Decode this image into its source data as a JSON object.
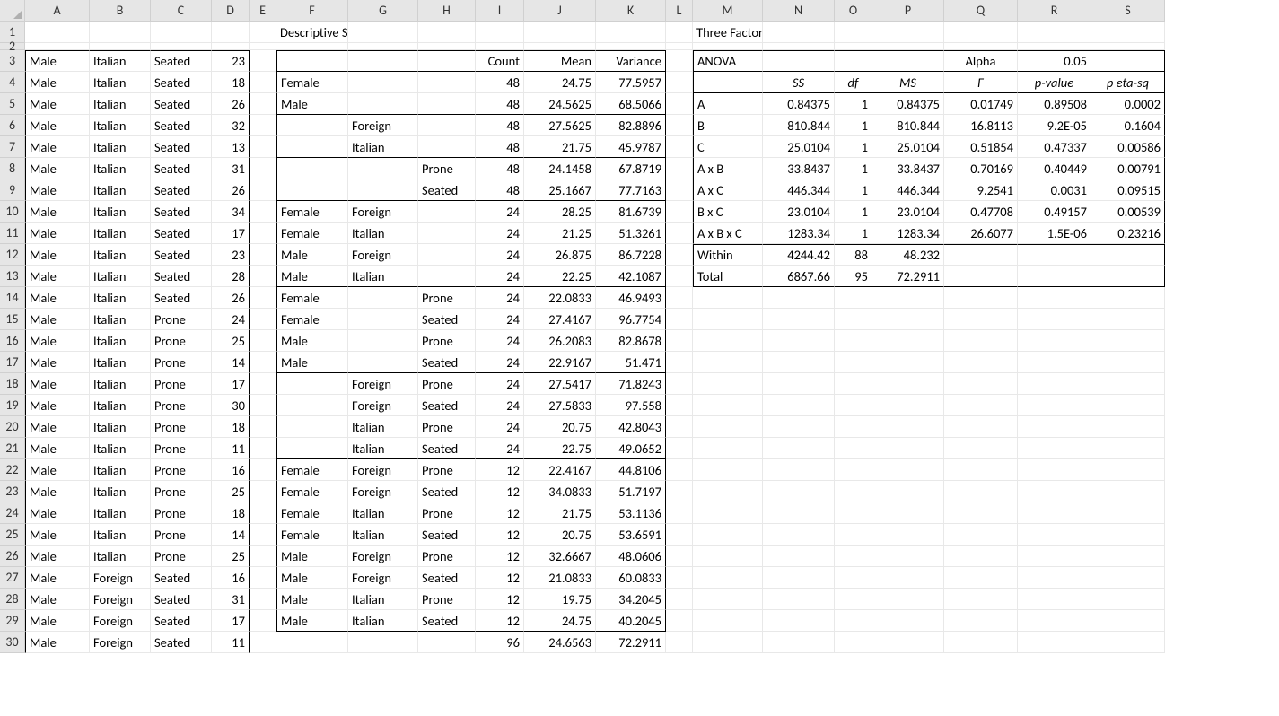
{
  "columns": [
    "A",
    "B",
    "C",
    "D",
    "E",
    "F",
    "G",
    "H",
    "I",
    "J",
    "K",
    "L",
    "M",
    "N",
    "O",
    "P",
    "Q",
    "R",
    "S"
  ],
  "rowCount": 30,
  "titles": {
    "descr": "Descriptive Statistics",
    "anova3": "Three Factor Anova (via Regression)"
  },
  "descrHeaders": {
    "count": "Count",
    "mean": "Mean",
    "variance": "Variance"
  },
  "anovaHeaders": {
    "anova": "ANOVA",
    "alpha": "Alpha",
    "alphaVal": "0.05",
    "ss": "SS",
    "df": "df",
    "ms": "MS",
    "F": "F",
    "pval": "p-value",
    "peta": "p eta-sq"
  },
  "raw": [
    {
      "r": 3,
      "a": "Male",
      "b": "Italian",
      "c": "Seated",
      "d": 23
    },
    {
      "r": 4,
      "a": "Male",
      "b": "Italian",
      "c": "Seated",
      "d": 18
    },
    {
      "r": 5,
      "a": "Male",
      "b": "Italian",
      "c": "Seated",
      "d": 26
    },
    {
      "r": 6,
      "a": "Male",
      "b": "Italian",
      "c": "Seated",
      "d": 32
    },
    {
      "r": 7,
      "a": "Male",
      "b": "Italian",
      "c": "Seated",
      "d": 13
    },
    {
      "r": 8,
      "a": "Male",
      "b": "Italian",
      "c": "Seated",
      "d": 31
    },
    {
      "r": 9,
      "a": "Male",
      "b": "Italian",
      "c": "Seated",
      "d": 26
    },
    {
      "r": 10,
      "a": "Male",
      "b": "Italian",
      "c": "Seated",
      "d": 34
    },
    {
      "r": 11,
      "a": "Male",
      "b": "Italian",
      "c": "Seated",
      "d": 17
    },
    {
      "r": 12,
      "a": "Male",
      "b": "Italian",
      "c": "Seated",
      "d": 23
    },
    {
      "r": 13,
      "a": "Male",
      "b": "Italian",
      "c": "Seated",
      "d": 28
    },
    {
      "r": 14,
      "a": "Male",
      "b": "Italian",
      "c": "Seated",
      "d": 26
    },
    {
      "r": 15,
      "a": "Male",
      "b": "Italian",
      "c": "Prone",
      "d": 24
    },
    {
      "r": 16,
      "a": "Male",
      "b": "Italian",
      "c": "Prone",
      "d": 25
    },
    {
      "r": 17,
      "a": "Male",
      "b": "Italian",
      "c": "Prone",
      "d": 14
    },
    {
      "r": 18,
      "a": "Male",
      "b": "Italian",
      "c": "Prone",
      "d": 17
    },
    {
      "r": 19,
      "a": "Male",
      "b": "Italian",
      "c": "Prone",
      "d": 30
    },
    {
      "r": 20,
      "a": "Male",
      "b": "Italian",
      "c": "Prone",
      "d": 18
    },
    {
      "r": 21,
      "a": "Male",
      "b": "Italian",
      "c": "Prone",
      "d": 11
    },
    {
      "r": 22,
      "a": "Male",
      "b": "Italian",
      "c": "Prone",
      "d": 16
    },
    {
      "r": 23,
      "a": "Male",
      "b": "Italian",
      "c": "Prone",
      "d": 25
    },
    {
      "r": 24,
      "a": "Male",
      "b": "Italian",
      "c": "Prone",
      "d": 18
    },
    {
      "r": 25,
      "a": "Male",
      "b": "Italian",
      "c": "Prone",
      "d": 14
    },
    {
      "r": 26,
      "a": "Male",
      "b": "Italian",
      "c": "Prone",
      "d": 25
    },
    {
      "r": 27,
      "a": "Male",
      "b": "Foreign",
      "c": "Seated",
      "d": 16
    },
    {
      "r": 28,
      "a": "Male",
      "b": "Foreign",
      "c": "Seated",
      "d": 31
    },
    {
      "r": 29,
      "a": "Male",
      "b": "Foreign",
      "c": "Seated",
      "d": 17
    },
    {
      "r": 30,
      "a": "Male",
      "b": "Foreign",
      "c": "Seated",
      "d": 11
    }
  ],
  "descr": [
    {
      "r": 4,
      "f": "Female",
      "g": "",
      "h": "",
      "i": 48,
      "j": "24.75",
      "k": "77.5957"
    },
    {
      "r": 5,
      "f": "Male",
      "g": "",
      "h": "",
      "i": 48,
      "j": "24.5625",
      "k": "68.5066"
    },
    {
      "r": 6,
      "f": "",
      "g": "Foreign",
      "h": "",
      "i": 48,
      "j": "27.5625",
      "k": "82.8896"
    },
    {
      "r": 7,
      "f": "",
      "g": "Italian",
      "h": "",
      "i": 48,
      "j": "21.75",
      "k": "45.9787"
    },
    {
      "r": 8,
      "f": "",
      "g": "",
      "h": "Prone",
      "i": 48,
      "j": "24.1458",
      "k": "67.8719"
    },
    {
      "r": 9,
      "f": "",
      "g": "",
      "h": "Seated",
      "i": 48,
      "j": "25.1667",
      "k": "77.7163"
    },
    {
      "r": 10,
      "f": "Female",
      "g": "Foreign",
      "h": "",
      "i": 24,
      "j": "28.25",
      "k": "81.6739"
    },
    {
      "r": 11,
      "f": "Female",
      "g": "Italian",
      "h": "",
      "i": 24,
      "j": "21.25",
      "k": "51.3261"
    },
    {
      "r": 12,
      "f": "Male",
      "g": "Foreign",
      "h": "",
      "i": 24,
      "j": "26.875",
      "k": "86.7228"
    },
    {
      "r": 13,
      "f": "Male",
      "g": "Italian",
      "h": "",
      "i": 24,
      "j": "22.25",
      "k": "42.1087"
    },
    {
      "r": 14,
      "f": "Female",
      "g": "",
      "h": "Prone",
      "i": 24,
      "j": "22.0833",
      "k": "46.9493"
    },
    {
      "r": 15,
      "f": "Female",
      "g": "",
      "h": "Seated",
      "i": 24,
      "j": "27.4167",
      "k": "96.7754"
    },
    {
      "r": 16,
      "f": "Male",
      "g": "",
      "h": "Prone",
      "i": 24,
      "j": "26.2083",
      "k": "82.8678"
    },
    {
      "r": 17,
      "f": "Male",
      "g": "",
      "h": "Seated",
      "i": 24,
      "j": "22.9167",
      "k": "51.471"
    },
    {
      "r": 18,
      "f": "",
      "g": "Foreign",
      "h": "Prone",
      "i": 24,
      "j": "27.5417",
      "k": "71.8243"
    },
    {
      "r": 19,
      "f": "",
      "g": "Foreign",
      "h": "Seated",
      "i": 24,
      "j": "27.5833",
      "k": "97.558"
    },
    {
      "r": 20,
      "f": "",
      "g": "Italian",
      "h": "Prone",
      "i": 24,
      "j": "20.75",
      "k": "42.8043"
    },
    {
      "r": 21,
      "f": "",
      "g": "Italian",
      "h": "Seated",
      "i": 24,
      "j": "22.75",
      "k": "49.0652"
    },
    {
      "r": 22,
      "f": "Female",
      "g": "Foreign",
      "h": "Prone",
      "i": 12,
      "j": "22.4167",
      "k": "44.8106"
    },
    {
      "r": 23,
      "f": "Female",
      "g": "Foreign",
      "h": "Seated",
      "i": 12,
      "j": "34.0833",
      "k": "51.7197"
    },
    {
      "r": 24,
      "f": "Female",
      "g": "Italian",
      "h": "Prone",
      "i": 12,
      "j": "21.75",
      "k": "53.1136"
    },
    {
      "r": 25,
      "f": "Female",
      "g": "Italian",
      "h": "Seated",
      "i": 12,
      "j": "20.75",
      "k": "53.6591"
    },
    {
      "r": 26,
      "f": "Male",
      "g": "Foreign",
      "h": "Prone",
      "i": 12,
      "j": "32.6667",
      "k": "48.0606"
    },
    {
      "r": 27,
      "f": "Male",
      "g": "Foreign",
      "h": "Seated",
      "i": 12,
      "j": "21.0833",
      "k": "60.0833"
    },
    {
      "r": 28,
      "f": "Male",
      "g": "Italian",
      "h": "Prone",
      "i": 12,
      "j": "19.75",
      "k": "34.2045"
    },
    {
      "r": 29,
      "f": "Male",
      "g": "Italian",
      "h": "Seated",
      "i": 12,
      "j": "24.75",
      "k": "40.2045"
    },
    {
      "r": 30,
      "f": "",
      "g": "",
      "h": "",
      "i": 96,
      "j": "24.6563",
      "k": "72.2911"
    }
  ],
  "anova": [
    {
      "r": 5,
      "src": "A",
      "ss": "0.84375",
      "df": "1",
      "ms": "0.84375",
      "F": "0.01749",
      "p": "0.89508",
      "eta": "0.0002"
    },
    {
      "r": 6,
      "src": "B",
      "ss": "810.844",
      "df": "1",
      "ms": "810.844",
      "F": "16.8113",
      "p": "9.2E-05",
      "eta": "0.1604"
    },
    {
      "r": 7,
      "src": "C",
      "ss": "25.0104",
      "df": "1",
      "ms": "25.0104",
      "F": "0.51854",
      "p": "0.47337",
      "eta": "0.00586"
    },
    {
      "r": 8,
      "src": "A x B",
      "ss": "33.8437",
      "df": "1",
      "ms": "33.8437",
      "F": "0.70169",
      "p": "0.40449",
      "eta": "0.00791"
    },
    {
      "r": 9,
      "src": "A x C",
      "ss": "446.344",
      "df": "1",
      "ms": "446.344",
      "F": "9.2541",
      "p": "0.0031",
      "eta": "0.09515"
    },
    {
      "r": 10,
      "src": "B x C",
      "ss": "23.0104",
      "df": "1",
      "ms": "23.0104",
      "F": "0.47708",
      "p": "0.49157",
      "eta": "0.00539"
    },
    {
      "r": 11,
      "src": "A x B x C",
      "ss": "1283.34",
      "df": "1",
      "ms": "1283.34",
      "F": "26.6077",
      "p": "1.5E-06",
      "eta": "0.23216"
    },
    {
      "r": 12,
      "src": "Within",
      "ss": "4244.42",
      "df": "88",
      "ms": "48.232",
      "F": "",
      "p": "",
      "eta": ""
    },
    {
      "r": 13,
      "src": "Total",
      "ss": "6867.66",
      "df": "95",
      "ms": "72.2911",
      "F": "",
      "p": "",
      "eta": ""
    }
  ]
}
